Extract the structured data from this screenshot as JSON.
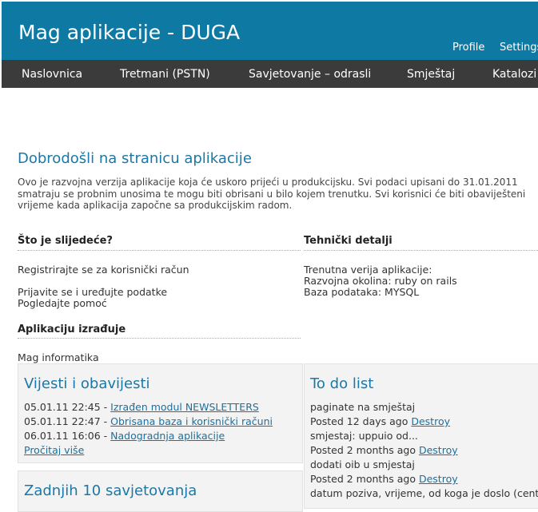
{
  "header": {
    "title": "Mag aplikacije - DUGA",
    "user_links": [
      "Profile",
      "Settings"
    ]
  },
  "nav": {
    "items": [
      "Naslovnica",
      "Tretmani (PSTN)",
      "Savjetovanje – odrasli",
      "Smještaj",
      "Katalozi"
    ]
  },
  "welcome": {
    "title": "Dobrodošli na stranicu aplikacije",
    "lines": [
      "Ovo je razvojna verzija aplikacije koja će uskoro prijeći u produkcijsku. Svi podaci upisani do 31.01.2011",
      "smatraju se probnim unosima te mogu biti obrisani u bilo kojem trenutku. Svi korisnici će biti obaviješteni",
      "vrijeme kada aplikacija započne sa produkcijskim radom."
    ]
  },
  "next": {
    "heading": "Što je slijedeće?",
    "register": "Registrirajte se za korisnički račun",
    "login": "Prijavite se i uređujte podatke",
    "help": "Pogledajte pomoć"
  },
  "tech": {
    "heading": "Tehnički detalji",
    "version": "Trenutna verija aplikacije:",
    "env": "Razvojna okolina: ruby on rails",
    "db": "Baza podataka: MYSQL"
  },
  "author": {
    "heading": "Aplikaciju izrađuje",
    "name": "Mag informatika"
  },
  "news": {
    "title": "Vijesti i obavijesti",
    "items": [
      {
        "date": "05.01.11 22:45 -",
        "link": "Izrađen modul NEWSLETTERS"
      },
      {
        "date": "05.01.11 22:47 -",
        "link": "Obrisana baza i korisnički računi"
      },
      {
        "date": "06.01.11 16:06 -",
        "link": "Nadogradnja aplikacije"
      }
    ],
    "more": "Pročitaj više"
  },
  "consult": {
    "title": "Zadnjih 10 savjetovanja"
  },
  "todo": {
    "title": "To do list",
    "entries": [
      {
        "text": "paginate na smještaj",
        "posted": "Posted 12 days ago",
        "action": "Destroy"
      },
      {
        "text": "smjestaj: uppuio od...",
        "posted": "Posted 2 months ago",
        "action": "Destroy"
      },
      {
        "text": "dodati oib u smjestaj",
        "posted": "Posted 2 months ago",
        "action": "Destroy"
      },
      {
        "text": "datum poziva, vrijeme, od koga je doslo (centar"
      }
    ]
  }
}
